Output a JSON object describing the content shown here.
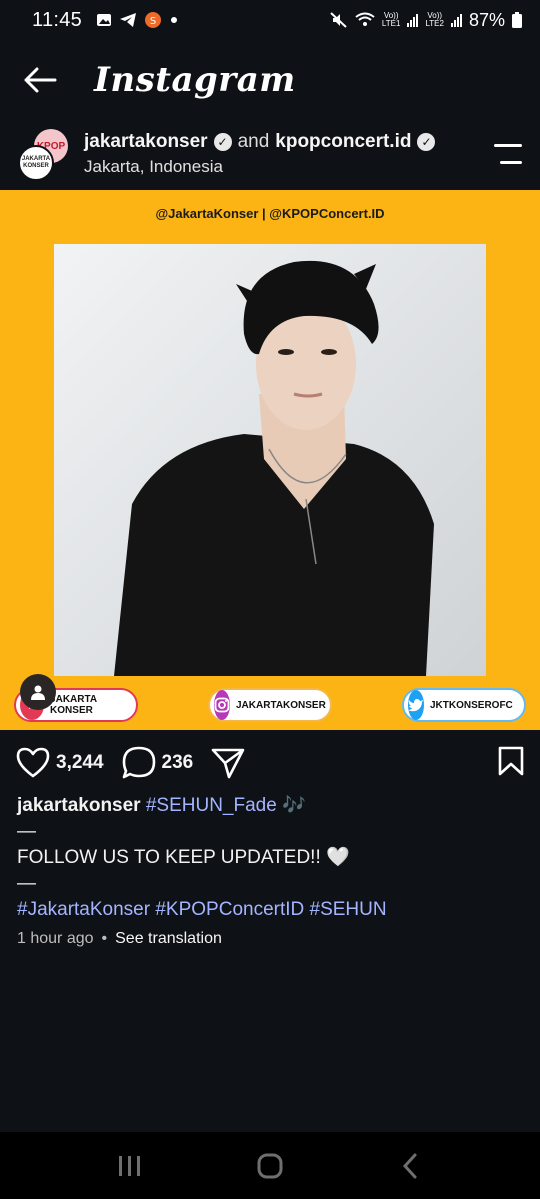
{
  "status_bar": {
    "time": "11:45",
    "battery": "87%",
    "sim1": "LTE1",
    "sim2": "LTE2",
    "volte": "Vo))"
  },
  "header": {
    "app_title": "Instagram"
  },
  "post": {
    "author1": "jakartakonser",
    "conjunction": "and",
    "author2": "kpopconcert.id",
    "location": "Jakarta, Indonesia",
    "avatar_back_text": "KPOP",
    "avatar_front_text": "JAKARTA KONSER",
    "media": {
      "background_color": "#fbb414",
      "handle_line": "@JakartaKonser | @KPOPConcert.ID",
      "pills": [
        {
          "label": "JAKARTA KONSER"
        },
        {
          "label": "JAKARTAKONSER"
        },
        {
          "label": "JKTKONSEROFC"
        }
      ]
    },
    "likes": "3,244",
    "comments": "236",
    "caption": {
      "username": "jakartakonser",
      "hashtag_main": "#SEHUN_Fade",
      "emoji": "🎶",
      "dash1": "—",
      "line2": "FOLLOW US TO KEEP UPDATED!! 🤍",
      "dash2": "—",
      "hashtags": "#JakartaKonser #KPOPConcertID #SEHUN"
    },
    "time_ago": "1 hour ago",
    "separator": "•",
    "see_translation": "See translation"
  },
  "colors": {
    "background": "#0e1116",
    "hashtag": "#a3b5ff",
    "accent_yellow": "#fbb414"
  }
}
